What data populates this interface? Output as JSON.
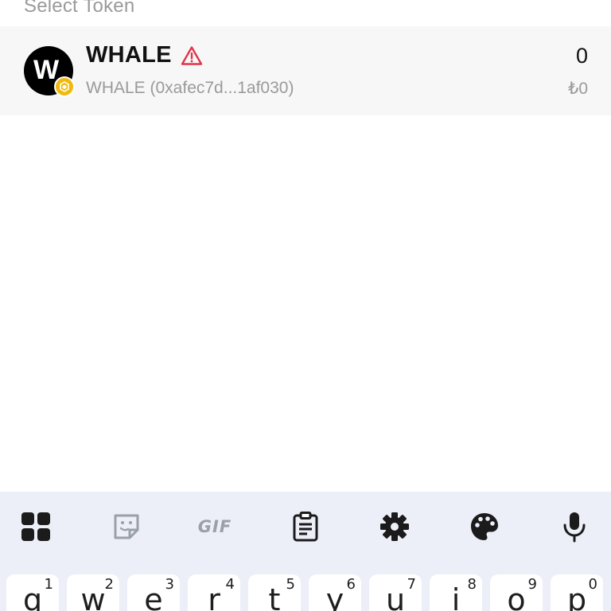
{
  "header": {
    "title": "Select Token"
  },
  "token": {
    "avatar_letter": "W",
    "symbol": "WHALE",
    "subtitle": "WHALE (0xafec7d...1af030)",
    "balance": "0",
    "fiat_value": "₺0",
    "warning_icon": "warning-triangle-icon",
    "chain_badge_icon": "bnb-chain-icon",
    "warning_color": "#e0344b",
    "chain_color": "#f0b90b"
  },
  "keyboard": {
    "toolbar_icons": [
      "apps-grid-icon",
      "sticker-icon",
      "gif-icon",
      "clipboard-icon",
      "settings-icon",
      "palette-icon",
      "microphone-icon"
    ],
    "gif_label": "GIF",
    "keys": [
      {
        "letter": "q",
        "num": "1"
      },
      {
        "letter": "w",
        "num": "2"
      },
      {
        "letter": "e",
        "num": "3"
      },
      {
        "letter": "r",
        "num": "4"
      },
      {
        "letter": "t",
        "num": "5"
      },
      {
        "letter": "y",
        "num": "6"
      },
      {
        "letter": "u",
        "num": "7"
      },
      {
        "letter": "i",
        "num": "8"
      },
      {
        "letter": "o",
        "num": "9"
      },
      {
        "letter": "p",
        "num": "0"
      }
    ]
  }
}
